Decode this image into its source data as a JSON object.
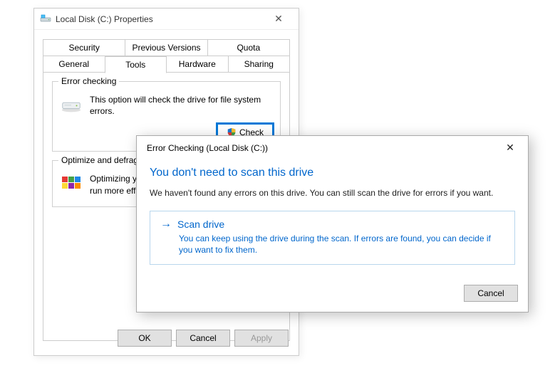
{
  "properties": {
    "title": "Local Disk (C:) Properties",
    "tabs_row1": [
      {
        "label": "Security"
      },
      {
        "label": "Previous Versions"
      },
      {
        "label": "Quota"
      }
    ],
    "tabs_row2": [
      {
        "label": "General"
      },
      {
        "label": "Tools",
        "active": true
      },
      {
        "label": "Hardware"
      },
      {
        "label": "Sharing"
      }
    ],
    "error_checking": {
      "legend": "Error checking",
      "text": "This option will check the drive for file system errors.",
      "button": "Check"
    },
    "optimize": {
      "legend": "Optimize and defragment drive",
      "text": "Optimizing your computer's drives can help it run more efficiently."
    },
    "buttons": {
      "ok": "OK",
      "cancel": "Cancel",
      "apply": "Apply"
    }
  },
  "modal": {
    "title": "Error Checking (Local Disk (C:))",
    "heading": "You don't need to scan this drive",
    "desc": "We haven't found any errors on this drive. You can still scan the drive for errors if you want.",
    "action_title": "Scan drive",
    "action_sub": "You can keep using the drive during the scan. If errors are found, you can decide if you want to fix them.",
    "cancel": "Cancel"
  }
}
